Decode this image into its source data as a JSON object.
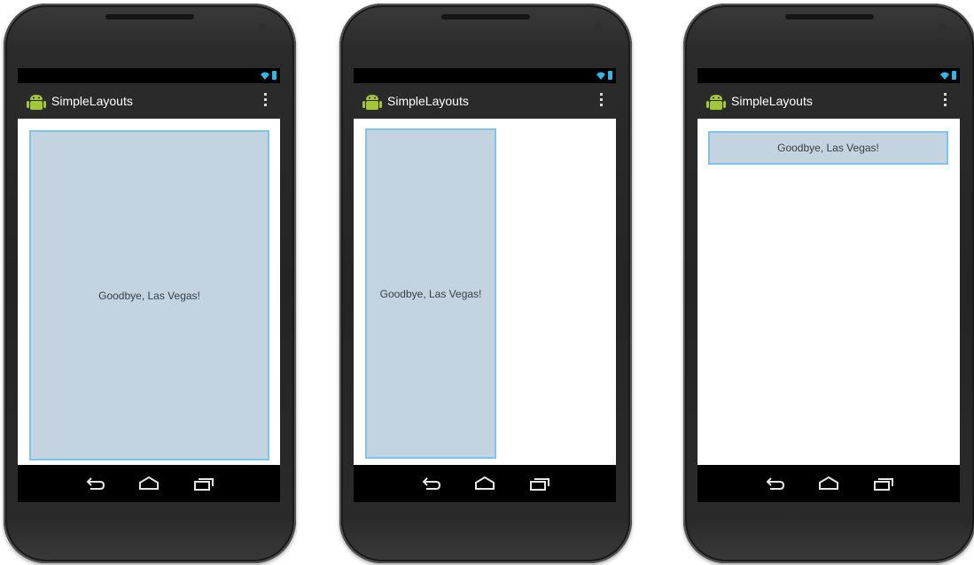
{
  "app": {
    "title": "SimpleLayouts"
  },
  "phones": [
    {
      "text": "Goodbye, Las Vegas!"
    },
    {
      "text": "Goodbye, Las Vegas!"
    },
    {
      "text": "Goodbye, Las Vegas!"
    }
  ],
  "colors": {
    "text_view_bg": "#c3d3e0",
    "text_view_border": "#7ec3e8",
    "action_bar": "#2a2a2a",
    "status_accent": "#33b5e5"
  },
  "icons": {
    "status": [
      "wifi-icon",
      "battery-icon"
    ],
    "action_bar": [
      "android-icon",
      "overflow-menu-icon"
    ],
    "nav": [
      "back-icon",
      "home-icon",
      "recent-apps-icon"
    ]
  }
}
